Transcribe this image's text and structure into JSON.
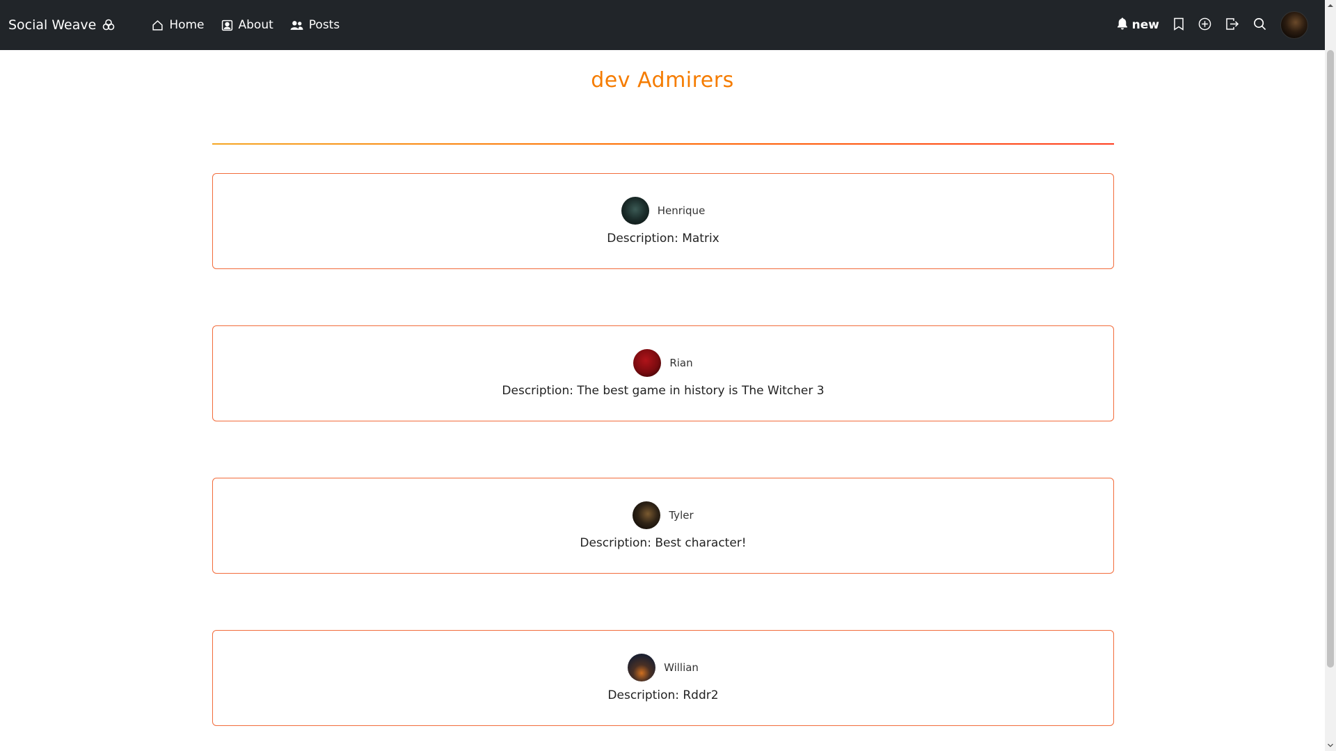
{
  "navbar": {
    "brand": "Social Weave",
    "links": [
      {
        "label": "Home",
        "icon": "home-icon"
      },
      {
        "label": "About",
        "icon": "person-badge-icon"
      },
      {
        "label": "Posts",
        "icon": "people-icon"
      }
    ],
    "notifications_label": "new"
  },
  "page": {
    "title": "dev Admirers"
  },
  "admirers": [
    {
      "name": "Henrique",
      "description": "Description: Matrix"
    },
    {
      "name": "Rian",
      "description": "Description: The best game in history is The Witcher 3"
    },
    {
      "name": "Tyler",
      "description": "Description: Best character!"
    },
    {
      "name": "Willian",
      "description": "Description: Rddr2"
    }
  ],
  "colors": {
    "accent": "#f57c00",
    "card_border": "#f26b3a",
    "navbar_bg": "#212529"
  }
}
